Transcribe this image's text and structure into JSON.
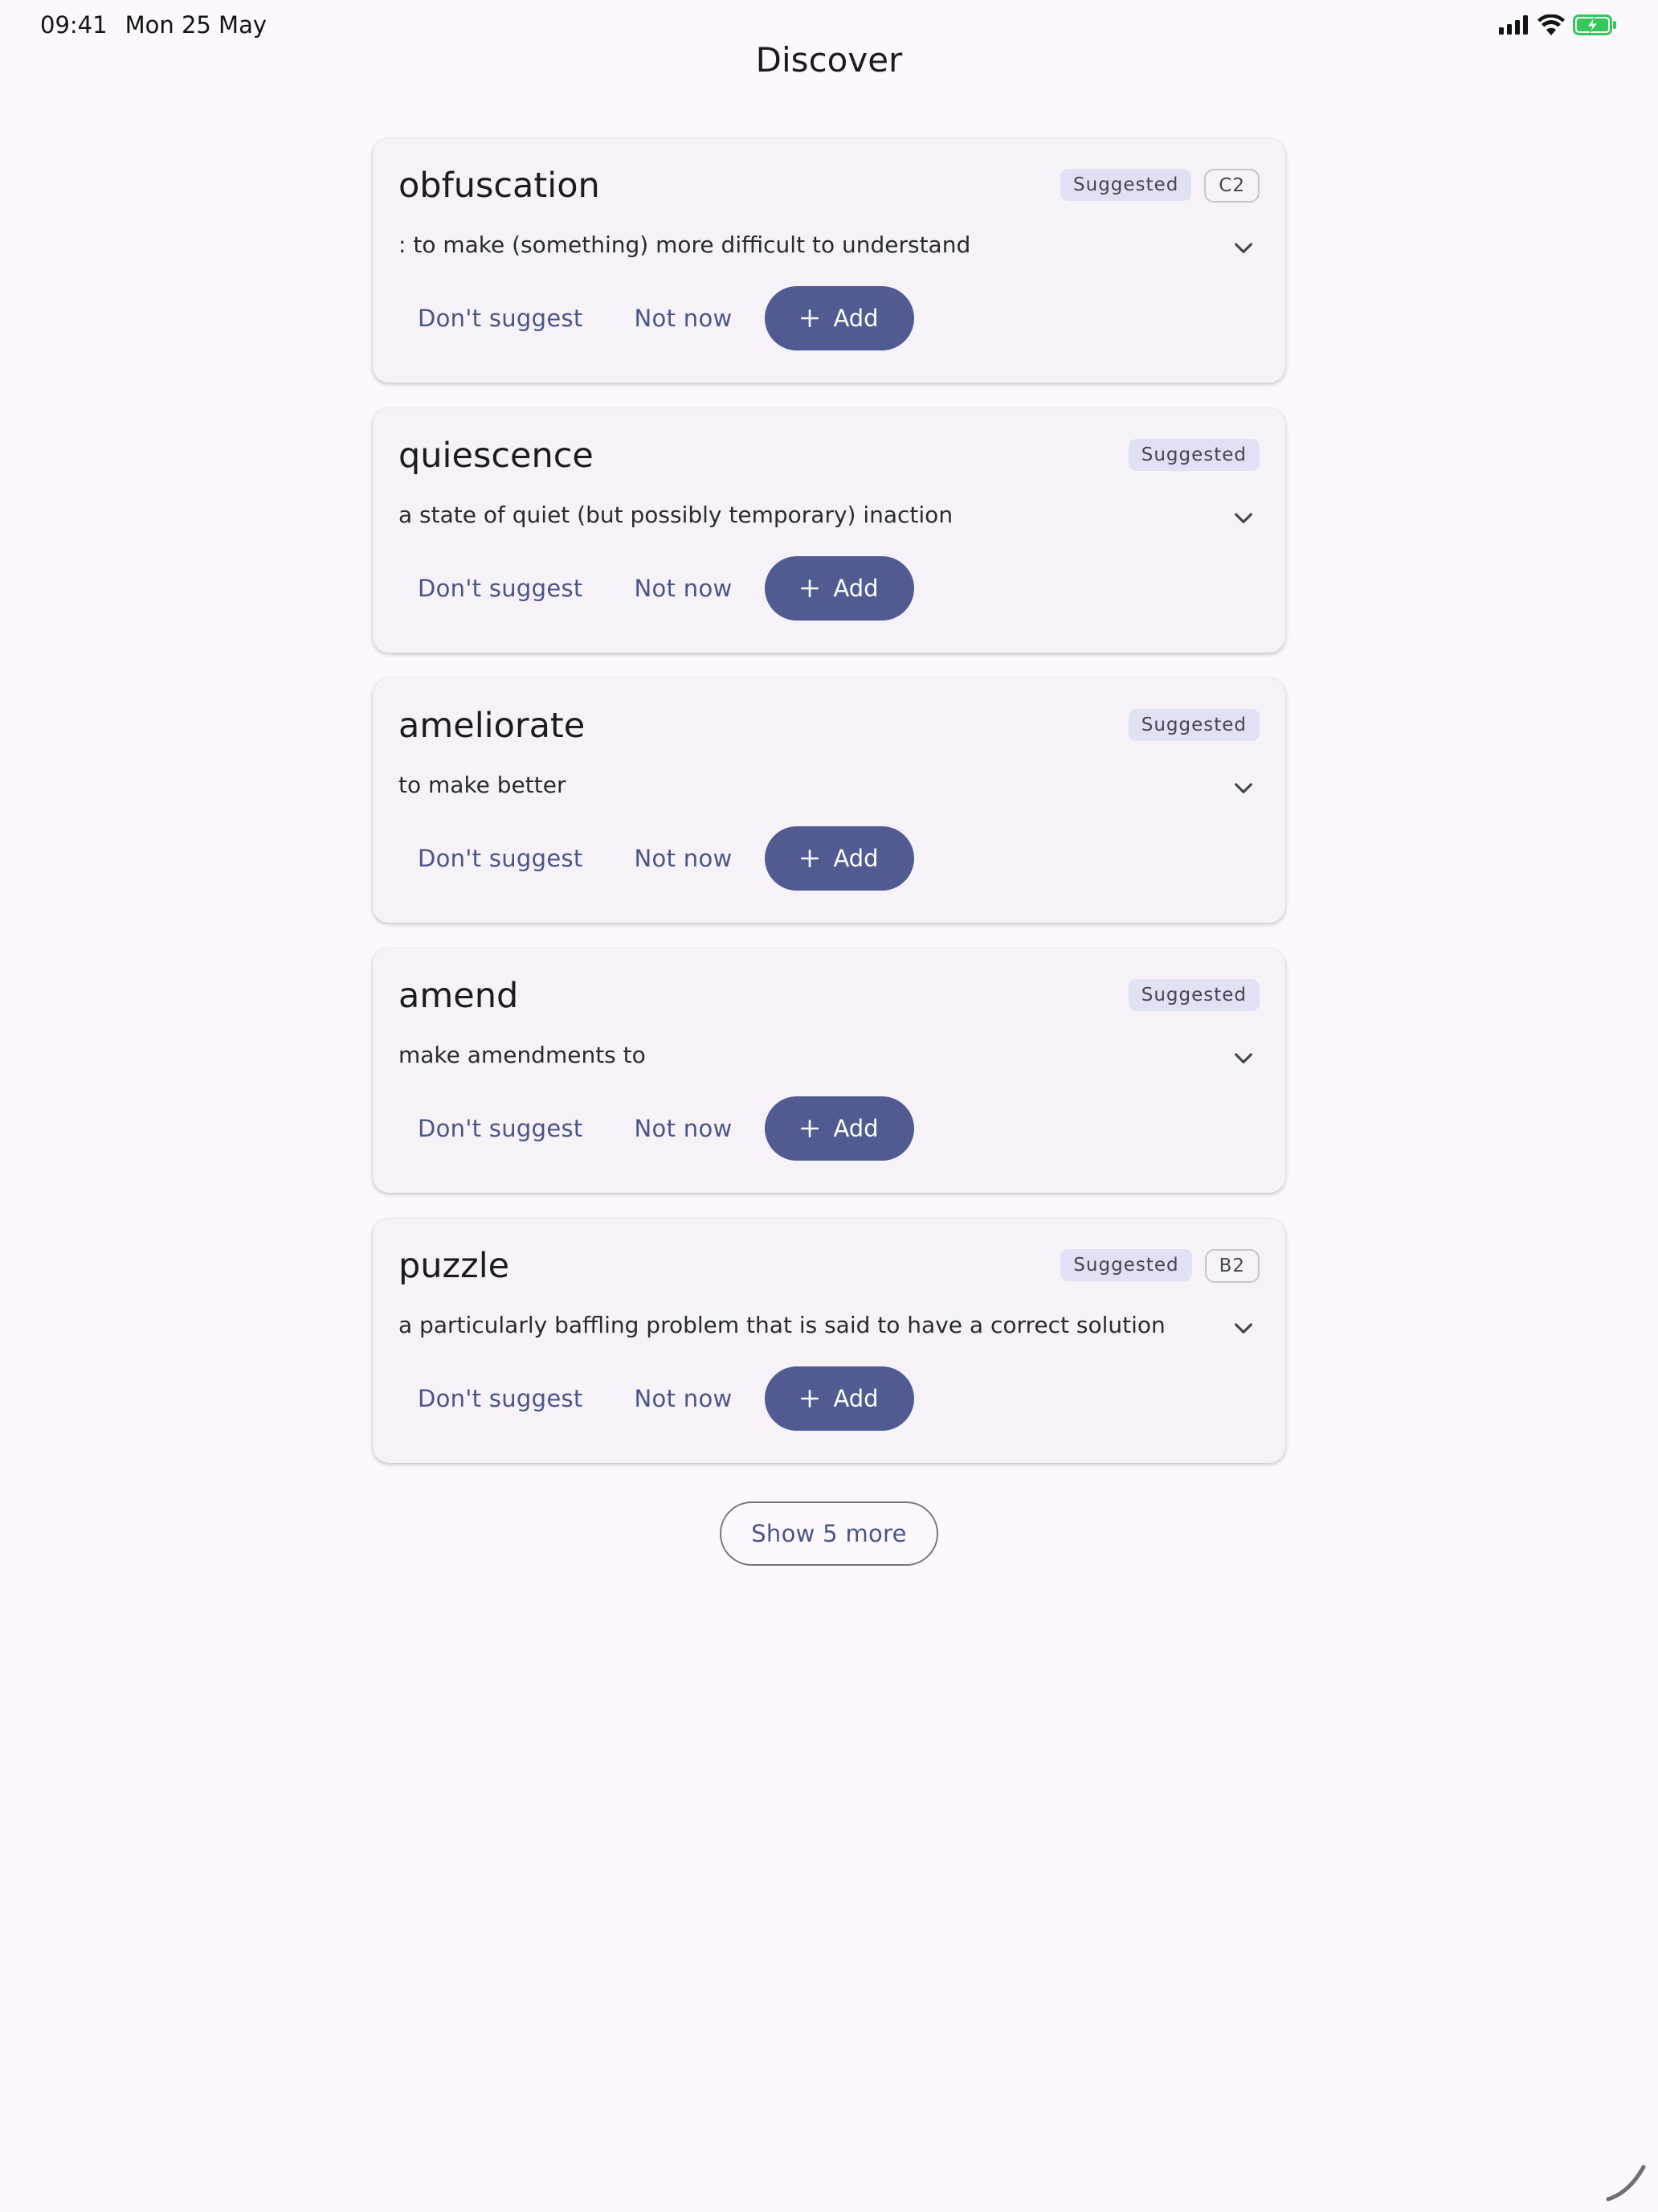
{
  "status_bar": {
    "time": "09:41",
    "date": "Mon 25 May"
  },
  "header": {
    "title": "Discover"
  },
  "cards": [
    {
      "word": "obfuscation",
      "badge": "Suggested",
      "level": "C2",
      "definition": ": to make (something) more difficult to understand",
      "dont_suggest": "Don't suggest",
      "not_now": "Not now",
      "add": "Add"
    },
    {
      "word": "quiescence",
      "badge": "Suggested",
      "level": "",
      "definition": "a state of quiet (but possibly temporary) inaction",
      "dont_suggest": "Don't suggest",
      "not_now": "Not now",
      "add": "Add"
    },
    {
      "word": "ameliorate",
      "badge": "Suggested",
      "level": "",
      "definition": "to make better",
      "dont_suggest": "Don't suggest",
      "not_now": "Not now",
      "add": "Add"
    },
    {
      "word": "amend",
      "badge": "Suggested",
      "level": "",
      "definition": "make amendments to",
      "dont_suggest": "Don't suggest",
      "not_now": "Not now",
      "add": "Add"
    },
    {
      "word": "puzzle",
      "badge": "Suggested",
      "level": "B2",
      "definition": "a particularly baffling problem that is said to have a correct solution",
      "dont_suggest": "Don't suggest",
      "not_now": "Not now",
      "add": "Add"
    }
  ],
  "show_more": {
    "label": "Show 5 more"
  },
  "colors": {
    "primary": "#515b92",
    "background": "#fcf8fe",
    "card": "#f6f2f7",
    "badge": "#e2e0f5",
    "battery": "#34c759"
  },
  "icons": [
    "cellular-signal-icon",
    "wifi-icon",
    "battery-charging-icon",
    "chevron-down-icon",
    "plus-icon"
  ]
}
